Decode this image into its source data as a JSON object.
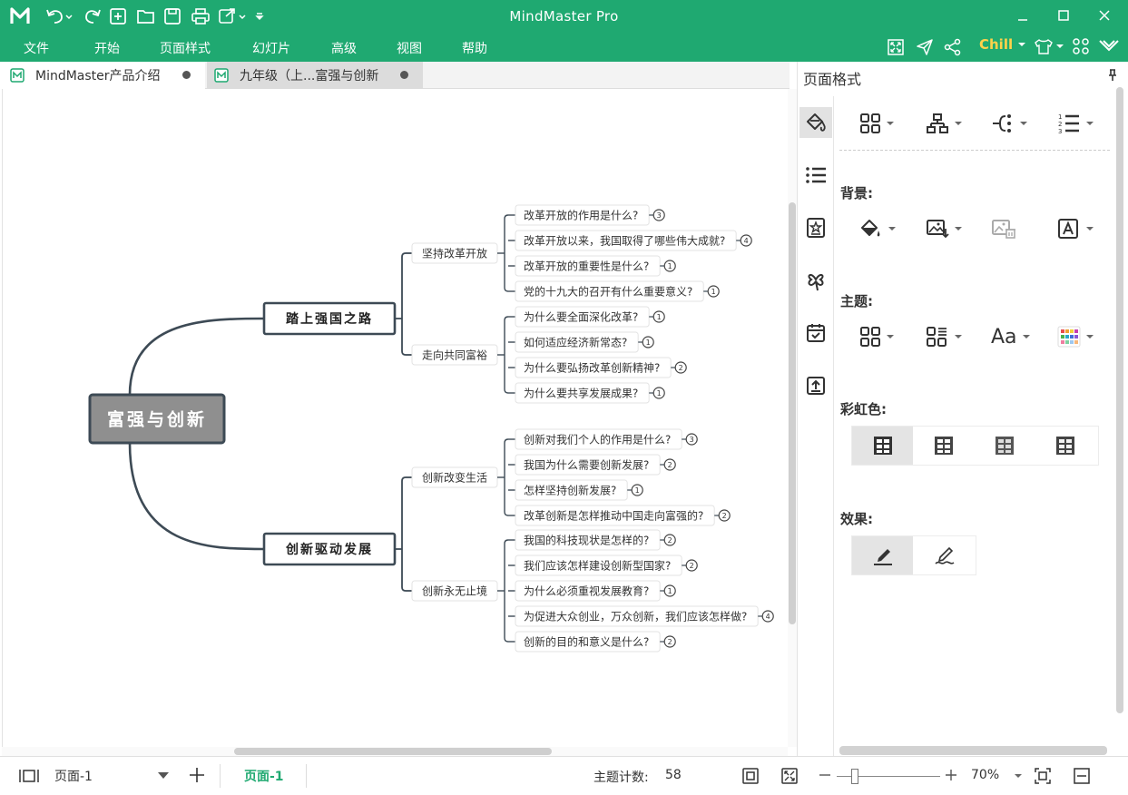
{
  "app": {
    "title": "MindMaster Pro"
  },
  "menu": {
    "items": [
      "文件",
      "开始",
      "页面样式",
      "幻灯片",
      "高级",
      "视图",
      "帮助"
    ],
    "theme_label": "Chill"
  },
  "tabs": [
    {
      "label": "MindMaster产品介绍"
    },
    {
      "label": "九年级（上...富强与创新"
    }
  ],
  "mindmap": {
    "root": "富强与创新",
    "branches": [
      {
        "label": "踏上强国之路",
        "children": [
          {
            "label": "坚持改革开放",
            "leaves": [
              {
                "text": "改革开放的作用是什么?",
                "count": "3"
              },
              {
                "text": "改革开放以来，我国取得了哪些伟大成就?",
                "count": "4"
              },
              {
                "text": "改革开放的重要性是什么?",
                "count": "1"
              },
              {
                "text": "党的十九大的召开有什么重要意义?",
                "count": "1"
              }
            ]
          },
          {
            "label": "走向共同富裕",
            "leaves": [
              {
                "text": "为什么要全面深化改革?",
                "count": "1"
              },
              {
                "text": "如何适应经济新常态?",
                "count": "1"
              },
              {
                "text": "为什么要弘扬改革创新精神?",
                "count": "2"
              },
              {
                "text": "为什么要共享发展成果?",
                "count": "1"
              }
            ]
          }
        ]
      },
      {
        "label": "创新驱动发展",
        "children": [
          {
            "label": "创新改变生活",
            "leaves": [
              {
                "text": "创新对我们个人的作用是什么?",
                "count": "3"
              },
              {
                "text": "我国为什么需要创新发展?",
                "count": "2"
              },
              {
                "text": "怎样坚持创新发展?",
                "count": "1"
              },
              {
                "text": "改革创新是怎样推动中国走向富强的?",
                "count": "2"
              }
            ]
          },
          {
            "label": "创新永无止境",
            "leaves": [
              {
                "text": "我国的科技现状是怎样的?",
                "count": "2"
              },
              {
                "text": "我们应该怎样建设创新型国家?",
                "count": "2"
              },
              {
                "text": "为什么必须重视发展教育?",
                "count": "1"
              },
              {
                "text": "为促进大众创业，万众创新，我们应该怎样做?",
                "count": "4"
              },
              {
                "text": "创新的目的和意义是什么?",
                "count": "2"
              }
            ]
          }
        ]
      }
    ]
  },
  "panel": {
    "title": "页面格式",
    "background_label": "背景:",
    "theme_label": "主题:",
    "rainbow_label": "彩虹色:",
    "effect_label": "效果:",
    "font_button": "Aa"
  },
  "status": {
    "page_name": "页面-1",
    "active_page_tab": "页面-1",
    "topic_count_label": "主题计数:",
    "topic_count": "58",
    "zoom": "70%"
  },
  "colors": {
    "brand": "#1fa971",
    "accent_text": "#ffd24a",
    "node_border": "#3d4a55"
  }
}
